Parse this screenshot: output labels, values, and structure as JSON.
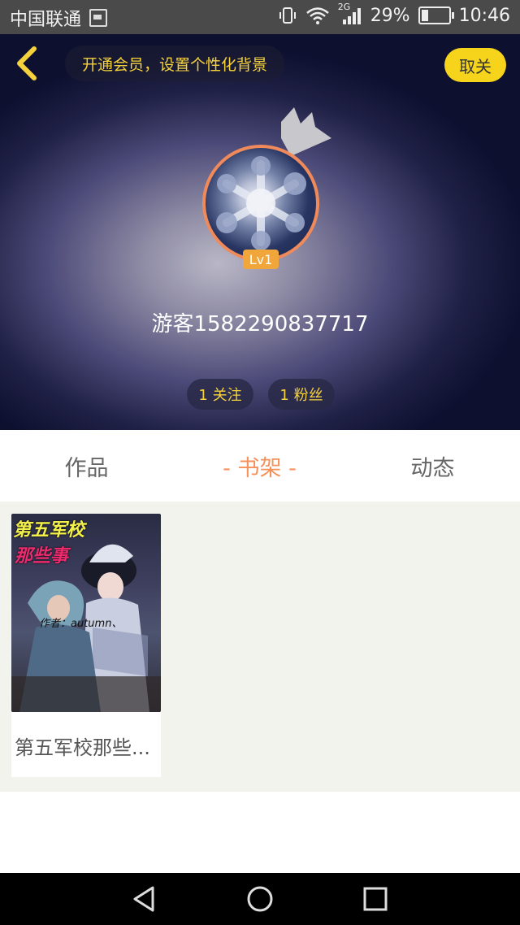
{
  "status_bar": {
    "carrier": "中国联通",
    "network_label": "2G",
    "battery_percent": "29%",
    "time": "10:46"
  },
  "header": {
    "vip_banner": "开通会员，设置个性化背景",
    "cancel_follow": "取关",
    "level": "Lv1",
    "username": "游客1582290837717",
    "following": "1 关注",
    "followers": "1 粉丝"
  },
  "tabs": [
    {
      "label": "作品",
      "active": false
    },
    {
      "label": "- 书架 -",
      "active": true
    },
    {
      "label": "动态",
      "active": false
    }
  ],
  "shelf": {
    "books": [
      {
        "title": "第五军校那些...",
        "cover_title_line1": "第五军校",
        "cover_title_line2": "那些事",
        "cover_author": "作者：autumn、"
      }
    ]
  },
  "colors": {
    "accent": "#f6915a",
    "vip_yellow": "#f5d23c",
    "cancel_button": "#f7d41c",
    "level_badge": "#f0a63a"
  }
}
